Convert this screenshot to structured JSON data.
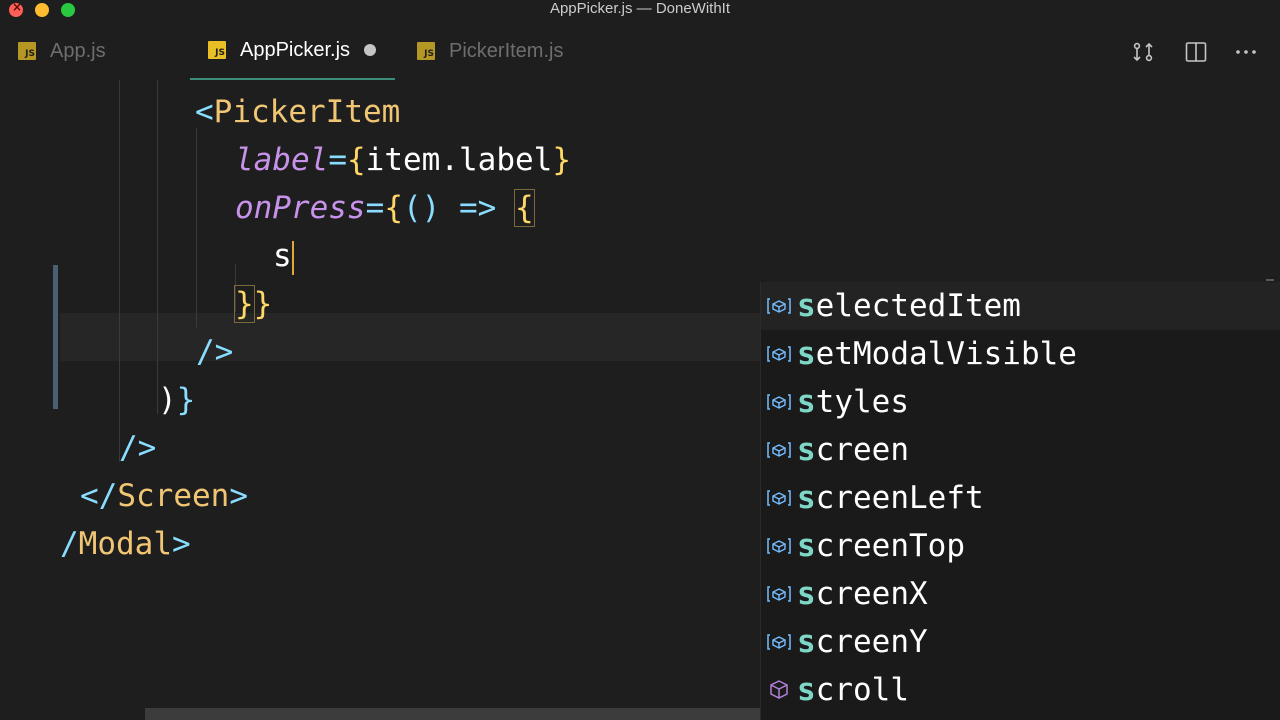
{
  "window": {
    "title": "AppPicker.js — DoneWithIt"
  },
  "tabs": [
    {
      "label": "App.js",
      "badge": "JS",
      "active": false
    },
    {
      "label": "AppPicker.js",
      "badge": "JS",
      "active": true,
      "dirty": true
    },
    {
      "label": "PickerItem.js",
      "badge": "JS",
      "active": false
    }
  ],
  "toolbar": {
    "icons": [
      "compare-changes-icon",
      "split-editor-icon",
      "more-actions-icon"
    ]
  },
  "code": {
    "line1": {
      "open": "<",
      "tag": "PickerItem"
    },
    "line2": {
      "attr": "label",
      "eq": "=",
      "brace_open": "{",
      "expr": "item.label",
      "brace_close": "}"
    },
    "line3": {
      "attr": "onPress",
      "eq": "=",
      "brace_open": "{",
      "params": "()",
      "arrow": " => ",
      "block_open": "{"
    },
    "line4": {
      "typed": "s"
    },
    "line5": {
      "block_close": "}",
      "brace_close": "}"
    },
    "line6": {
      "selfclose": "/>"
    },
    "line7": {
      "paren": ")",
      "brace": "}"
    },
    "line8": {
      "selfclose": "/>"
    },
    "line9": {
      "open": "</",
      "tag": "Screen",
      "close": ">"
    },
    "line10": {
      "open": "/",
      "tag": "Modal",
      "close": ">"
    }
  },
  "suggestions": [
    {
      "match": "s",
      "rest": "electedItem",
      "icon": "variable-icon",
      "selected": true
    },
    {
      "match": "s",
      "rest": "etModalVisible",
      "icon": "variable-icon"
    },
    {
      "match": "s",
      "rest": "tyles",
      "icon": "variable-icon"
    },
    {
      "match": "s",
      "rest": "creen",
      "icon": "variable-icon"
    },
    {
      "match": "s",
      "rest": "creenLeft",
      "icon": "variable-icon"
    },
    {
      "match": "s",
      "rest": "creenTop",
      "icon": "variable-icon"
    },
    {
      "match": "s",
      "rest": "creenX",
      "icon": "variable-icon"
    },
    {
      "match": "s",
      "rest": "creenY",
      "icon": "variable-icon"
    },
    {
      "match": "s",
      "rest": "croll",
      "icon": "method-cube-icon"
    }
  ]
}
